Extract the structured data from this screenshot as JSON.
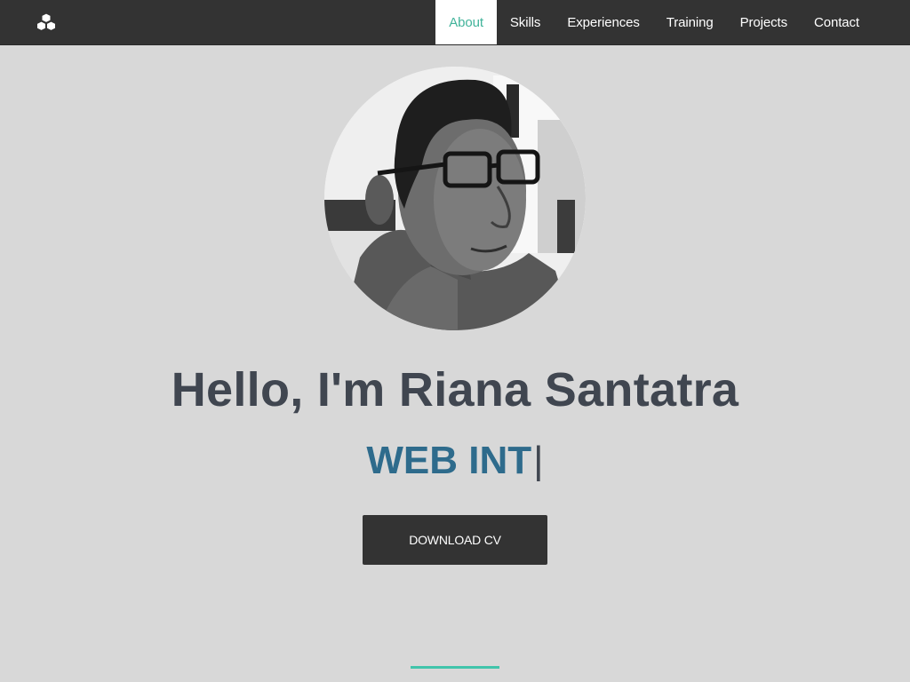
{
  "nav": {
    "brand_icon": "cubes-icon",
    "items": [
      {
        "label": "About",
        "active": true
      },
      {
        "label": "Skills",
        "active": false
      },
      {
        "label": "Experiences",
        "active": false
      },
      {
        "label": "Training",
        "active": false
      },
      {
        "label": "Projects",
        "active": false
      },
      {
        "label": "Contact",
        "active": false
      }
    ]
  },
  "hero": {
    "heading": "Hello, I'm Riana Santatra",
    "role_typed": "WEB INT",
    "cursor": "|",
    "download_label": "DOWNLOAD CV"
  },
  "colors": {
    "accent": "#41b39a",
    "navbar": "#333333",
    "background": "#d8d8d8",
    "heading": "#404650",
    "role": "#2e6b8c"
  }
}
